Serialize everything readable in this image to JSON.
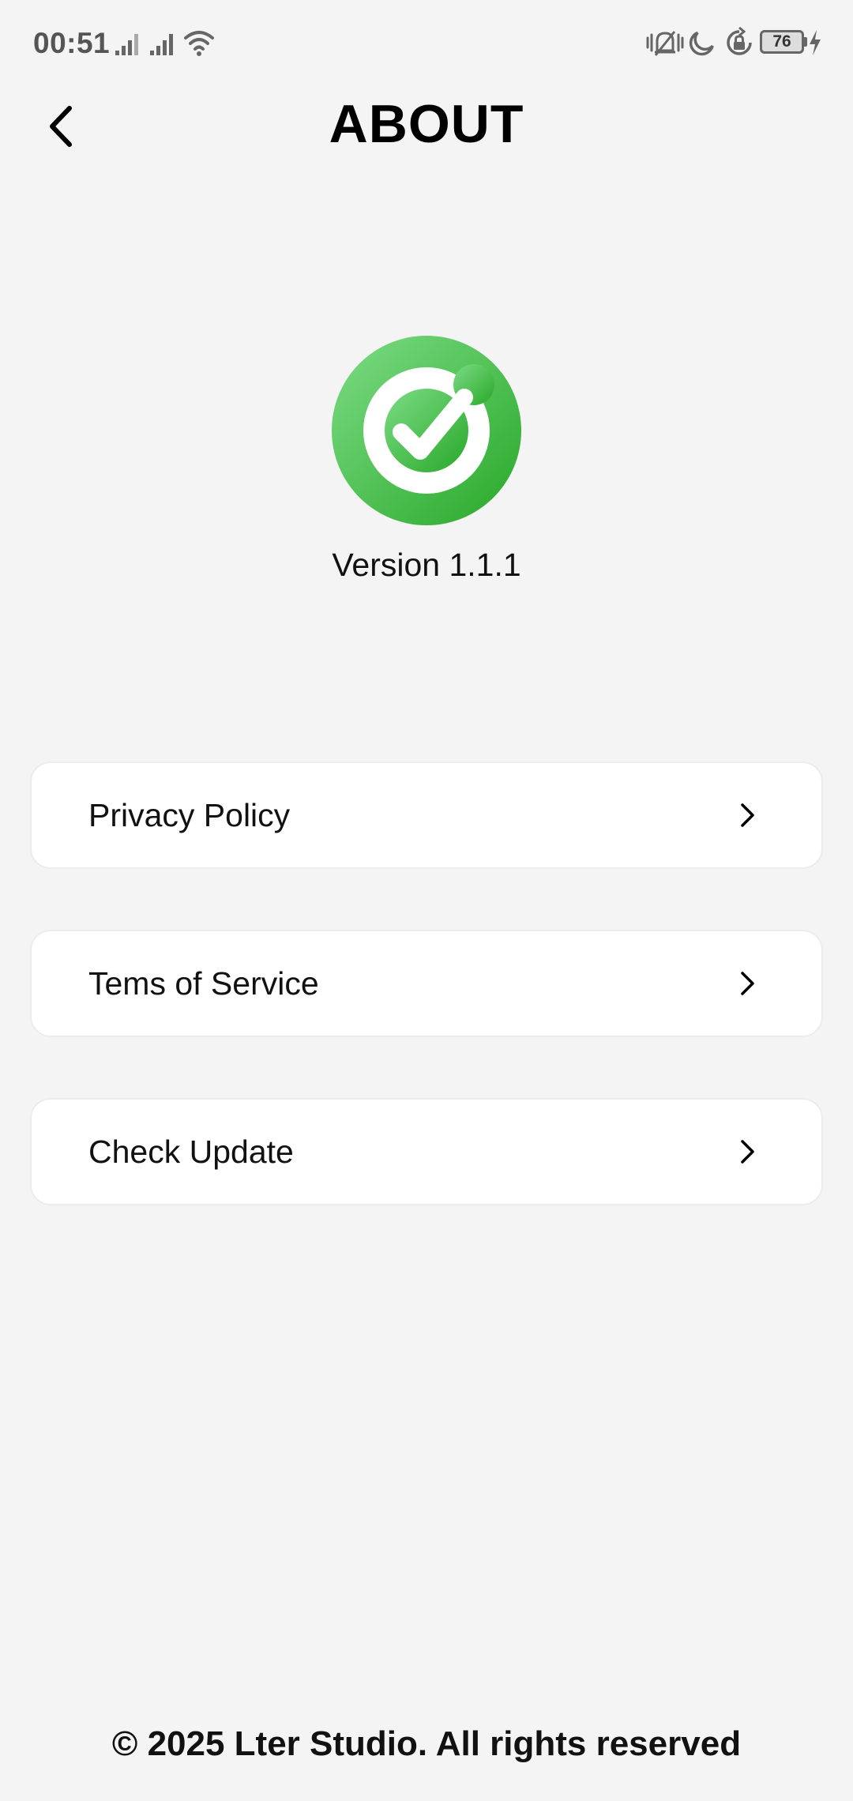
{
  "status_bar": {
    "time": "00:51",
    "battery_level": "76",
    "icons": [
      "cellular-signal-icon",
      "cellular-signal-icon",
      "wifi-icon",
      "vibrate-icon",
      "do-not-disturb-icon",
      "rotation-lock-icon",
      "battery-icon",
      "charging-icon"
    ]
  },
  "header": {
    "title": "ABOUT",
    "back_icon": "chevron-left-icon"
  },
  "app": {
    "logo_icon": "check-circle-logo-icon",
    "version": "Version 1.1.1",
    "colors": {
      "logo_green_light": "#74d77f",
      "logo_green_dark": "#2fae2f"
    }
  },
  "menu": {
    "items": [
      {
        "label": "Privacy Policy",
        "icon": "chevron-right-icon"
      },
      {
        "label": "Tems of Service",
        "icon": "chevron-right-icon"
      },
      {
        "label": "Check Update",
        "icon": "chevron-right-icon"
      }
    ]
  },
  "footer": {
    "copyright": "© 2025 Lter Studio. All rights reserved"
  }
}
